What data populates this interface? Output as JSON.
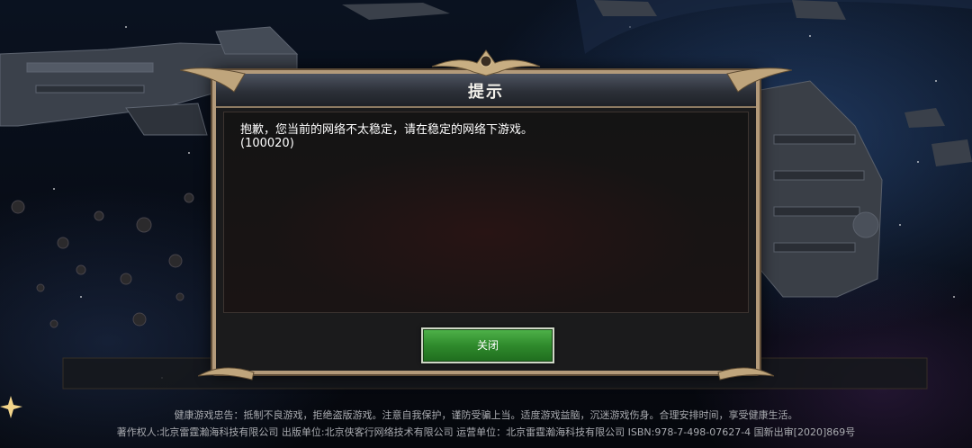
{
  "dialog": {
    "title": "提示",
    "message_line1": "抱歉，您当前的网络不太稳定，请在稳定的网络下游戏。",
    "message_line2": "(100020)",
    "close_label": "关闭"
  },
  "footer": {
    "health_notice": "健康游戏忠告：抵制不良游戏，拒绝盗版游戏。注意自我保护，谨防受骗上当。适度游戏益脑，沉迷游戏伤身。合理安排时间，享受健康生活。",
    "copyright": "著作权人:北京雷霆瀚海科技有限公司 出版单位:北京侠客行网络技术有限公司 运营单位：北京雷霆瀚海科技有限公司 ISBN:978-7-498-07627-4 国新出审[2020]869号"
  },
  "colors": {
    "button_green": "#2f8a2c",
    "frame_gold": "#b39a7a",
    "panel_dark": "#1b1b1c"
  }
}
